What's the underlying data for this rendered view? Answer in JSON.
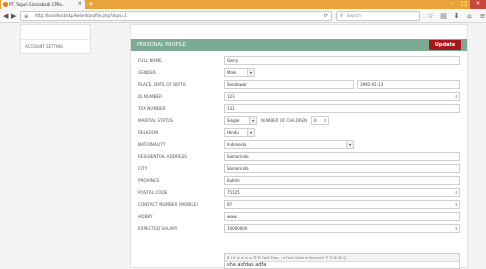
{
  "browser": {
    "tab_title": "PT. Teguh Sinarabadi CPRo...",
    "tab_close": "×",
    "new_tab": "+",
    "url": "http://localhost/skp/kelord/profile.php?skps=1",
    "search_placeholder": "Search",
    "win_min": "–",
    "win_max": "□",
    "win_close": "×"
  },
  "sidebar": {
    "items": [
      {
        "label": "ACCOUNT SETTING"
      }
    ]
  },
  "panel": {
    "title": "PERSONAL PROFILE",
    "update_label": "Update"
  },
  "form": {
    "full_name": {
      "label": "FULL NAME",
      "value": "Gerry"
    },
    "gender": {
      "label": "GENDER",
      "value": "Male"
    },
    "birth": {
      "label": "PLACE, DATE OF BIRTH",
      "place": "Sendawar",
      "date": "1992-01-13"
    },
    "id_number": {
      "label": "ID NUMBER",
      "value": "123"
    },
    "tax_number": {
      "label": "TAX NUMBER",
      "value": "131"
    },
    "marital": {
      "label": "MARITAL STATUS",
      "value": "Single",
      "children_label": "NUMBER OF CHILDREN",
      "children_value": "0"
    },
    "religion": {
      "label": "RELIGION",
      "value": "Hindu"
    },
    "nationality": {
      "label": "NATIONALITY",
      "value": "Indonesia"
    },
    "address": {
      "label": "RESIDENTIAL ADDRESS",
      "value": "Samarinda"
    },
    "city": {
      "label": "CITY",
      "value": "Samarinda"
    },
    "province": {
      "label": "PROVINCE",
      "value": "Kaltim"
    },
    "postal": {
      "label": "POSTAL CODE",
      "value": "75125"
    },
    "contact": {
      "label": "CONTACT NUMBER (MOBILE)",
      "value": "97"
    },
    "hobby": {
      "label": "HOBBY",
      "value": "www"
    },
    "salary": {
      "label": "EXPECTED SALARY",
      "value": "10000000"
    },
    "editor": {
      "toolbar": "B  I  U  ≡  ≡  ≡  ≡  ☰  ☰   Font Fam… ▾   Font Sizes ▾   Format ▾   ☷  ☷  ⊞  ⌘  ☺",
      "content": "sha asfdas adfa"
    }
  }
}
